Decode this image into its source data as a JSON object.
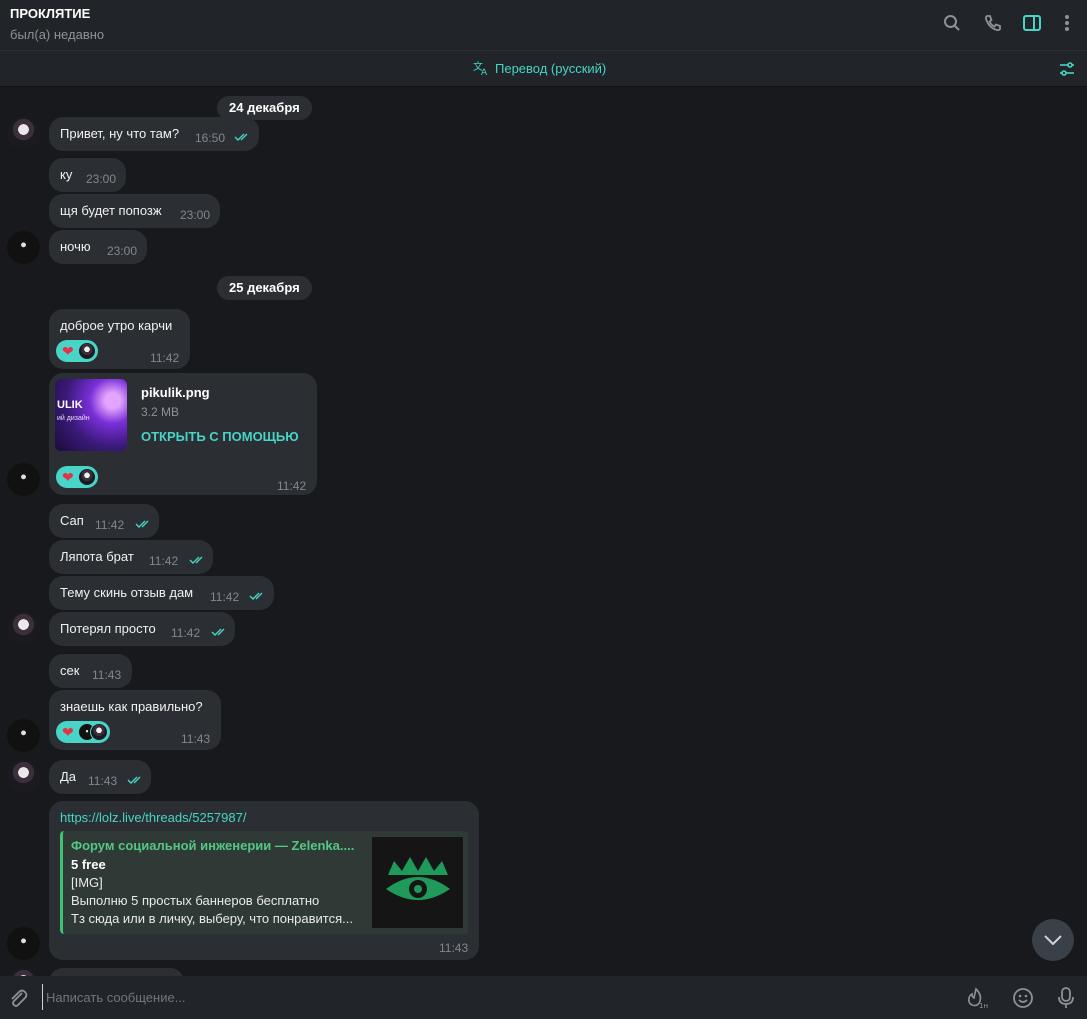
{
  "header": {
    "title": "ПРОКЛЯТИЕ",
    "status": "был(а) недавно",
    "icons": [
      "search-icon",
      "phone-icon",
      "sidebar-icon",
      "more-icon"
    ]
  },
  "translate": {
    "label": "Перевод (русский)"
  },
  "dates": [
    "24 декабря",
    "25 декабря"
  ],
  "messages": [
    {
      "text": "Привет, ну что там?",
      "time": "16:50",
      "read": true
    },
    {
      "text": "ку",
      "time": "23:00"
    },
    {
      "text": "щя будет попозж",
      "time": "23:00"
    },
    {
      "text": "ночю",
      "time": "23:00"
    },
    {
      "text": "доброе утро карчи",
      "time": "11:42",
      "reaction": "heart"
    },
    {
      "text": "",
      "time": "11:42"
    },
    {
      "text": "Сап",
      "time": "11:42",
      "read": true
    },
    {
      "text": "Ляпота брат",
      "time": "11:42",
      "read": true
    },
    {
      "text": "Тему скинь отзыв дам",
      "time": "11:42",
      "read": true
    },
    {
      "text": "Потерял просто",
      "time": "11:42",
      "read": true
    },
    {
      "text": "сек",
      "time": "11:43"
    },
    {
      "text": "знаешь как правильно?",
      "time": "11:43",
      "reaction": "heart"
    },
    {
      "text": "Да",
      "time": "11:43",
      "read": true
    },
    {
      "text": "",
      "time": "11:43"
    }
  ],
  "file": {
    "name": "pikulik.png",
    "size": "3.2 MB",
    "open_label": "ОТКРЫТЬ С ПОМОЩЬЮ",
    "thumb_text": "ULIK",
    "thumb_sub": "ий дизайн"
  },
  "link_message": {
    "url": "https://lolz.live/threads/5257987/",
    "preview_site": "Форум социальной инженерии — Zelenka....",
    "preview_title": "5 free",
    "preview_lines": [
      "[IMG]",
      "Выполню 5 простых баннеров бесплатно",
      "Тз сюда или в личку, выберу, что понравится..."
    ]
  },
  "composer": {
    "placeholder": "Написать сообщение..."
  },
  "colors": {
    "accent": "#48d4c6",
    "bubble": "#2b2f34",
    "background": "#17191c",
    "header": "#212529"
  }
}
